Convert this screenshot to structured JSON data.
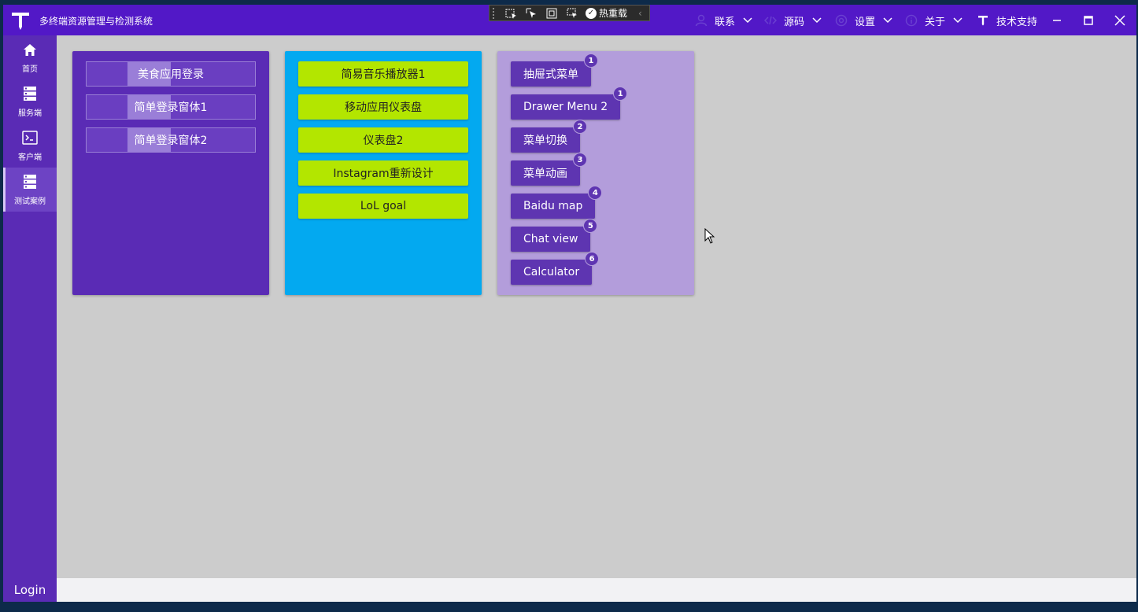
{
  "app": {
    "title": "多终端资源管理与检测系统"
  },
  "debug_toolbar": {
    "hot_reload_label": "热重载"
  },
  "menu": [
    {
      "label": "联系",
      "icon": "user-icon"
    },
    {
      "label": "源码",
      "icon": "code-icon"
    },
    {
      "label": "设置",
      "icon": "gear-icon"
    },
    {
      "label": "关于",
      "icon": "info-icon"
    }
  ],
  "support": {
    "label": "技术支持",
    "icon": "logo-t-icon"
  },
  "sidebar": {
    "items": [
      {
        "label": "首页",
        "icon": "home-icon"
      },
      {
        "label": "服务端",
        "icon": "server-icon"
      },
      {
        "label": "客户端",
        "icon": "terminal-icon"
      },
      {
        "label": "测试案例",
        "icon": "server-icon",
        "active": true
      }
    ],
    "login_label": "Login"
  },
  "cards": {
    "card1": {
      "buttons": [
        "美食应用登录",
        "简单登录窗体1",
        "简单登录窗体2"
      ]
    },
    "card2": {
      "buttons": [
        "简易音乐播放器1",
        "移动应用仪表盘",
        "仪表盘2",
        "Instagram重新设计",
        "LoL goal"
      ]
    },
    "card3": {
      "buttons": [
        {
          "label": "抽屉式菜单",
          "badge": "1"
        },
        {
          "label": "Drawer Menu 2",
          "badge": "1"
        },
        {
          "label": "菜单切换",
          "badge": "2"
        },
        {
          "label": "菜单动画",
          "badge": "3"
        },
        {
          "label": "Baidu map",
          "badge": "4"
        },
        {
          "label": "Chat view",
          "badge": "5"
        },
        {
          "label": "Calculator",
          "badge": "6"
        }
      ]
    }
  },
  "colors": {
    "titlebar": "#5218c7",
    "sidebar": "#5a2bb5",
    "card1": "#5a2bb5",
    "card2": "#03a9f0",
    "card3": "#b39ddb",
    "lime": "#b3e600",
    "content_bg": "#cccccc"
  }
}
